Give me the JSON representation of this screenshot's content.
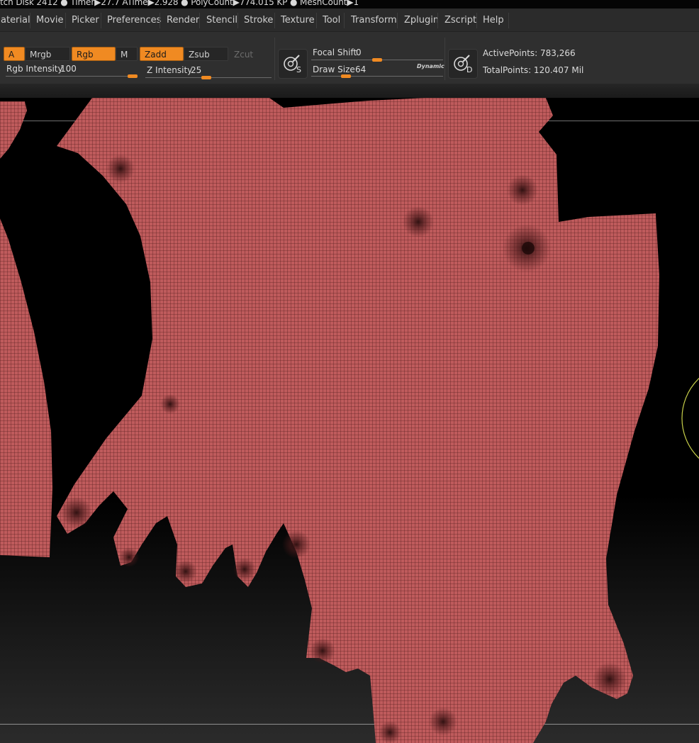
{
  "status_bar": {
    "text": "tch Disk 2412 ●  Timer▶27.7 ATime▶2.928 ● PolyCount▶774.015 KP  ● MeshCount▶1"
  },
  "menu": {
    "items": [
      "aterial",
      "Movie",
      "Picker",
      "Preferences",
      "Render",
      "Stencil",
      "Stroke",
      "Texture",
      "Tool",
      "Transform",
      "Zplugin",
      "Zscript",
      "Help"
    ]
  },
  "toolbar": {
    "a_label": "A",
    "mrgb_label": "Mrgb",
    "rgb_label": "Rgb",
    "m_label": "M",
    "zadd_label": "Zadd",
    "zsub_label": "Zsub",
    "zcut_label": "Zcut",
    "rgb_intensity_label": "Rgb Intensity",
    "rgb_intensity_value": "100",
    "z_intensity_label": "Z Intensity",
    "z_intensity_value": "25",
    "focal_shift_label": "Focal Shift",
    "focal_shift_value": "0",
    "draw_size_label": "Draw Size",
    "draw_size_value": "64",
    "dynamic_label": "Dynamic",
    "brush_s_letter": "S",
    "brush_d_letter": "D",
    "active_points": "ActivePoints: 783,266",
    "total_points": "TotalPoints: 120.407 Mil"
  },
  "colors": {
    "accent": "#f08a22",
    "mesh_fill": "#bf5b5c",
    "mesh_wire": "#5e2223",
    "cursor_ring": "#c9d14a"
  }
}
